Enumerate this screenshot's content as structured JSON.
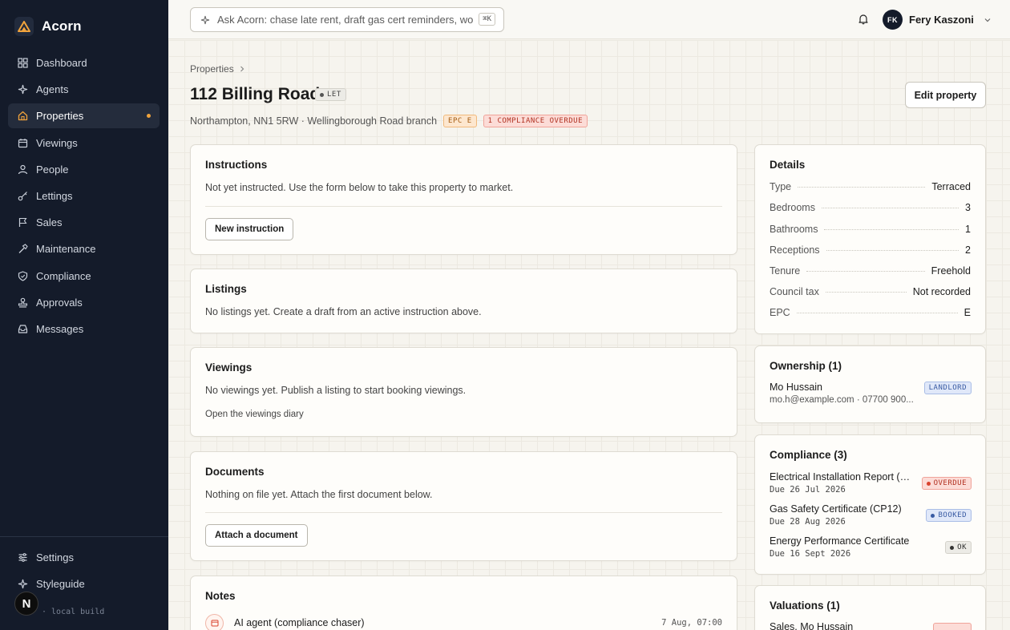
{
  "app": {
    "name": "Acorn",
    "build_label": "· local build"
  },
  "sidebar": {
    "items": [
      {
        "label": "Dashboard",
        "icon": "grid-icon"
      },
      {
        "label": "Agents",
        "icon": "sparkle-icon"
      },
      {
        "label": "Properties",
        "icon": "home-icon",
        "active": true
      },
      {
        "label": "Viewings",
        "icon": "calendar-icon"
      },
      {
        "label": "People",
        "icon": "person-icon"
      },
      {
        "label": "Lettings",
        "icon": "key-icon"
      },
      {
        "label": "Sales",
        "icon": "flag-icon"
      },
      {
        "label": "Maintenance",
        "icon": "hammer-icon"
      },
      {
        "label": "Compliance",
        "icon": "shield-icon"
      },
      {
        "label": "Approvals",
        "icon": "stamp-icon"
      },
      {
        "label": "Messages",
        "icon": "inbox-icon"
      }
    ],
    "bottom": [
      {
        "label": "Settings",
        "icon": "sliders-icon"
      },
      {
        "label": "Styleguide",
        "icon": "sparkle-icon"
      }
    ],
    "avatar_letter": "N",
    "active_dot_color": "#f0a33c"
  },
  "topbar": {
    "search_placeholder": "Ask Acorn: chase late rent, draft gas cert reminders, work th",
    "shortcut": "⌘K",
    "user_initials": "FK",
    "user_name": "Fery Kaszoni"
  },
  "page": {
    "breadcrumb": "Properties",
    "title": "112 Billing Road",
    "status_tag": "LET",
    "address": "Northampton, NN1 5RW · Wellingborough Road branch",
    "epc_tag": "EPC E",
    "overdue_tag": "1 COMPLIANCE OVERDUE",
    "edit_button": "Edit property"
  },
  "instructions": {
    "title": "Instructions",
    "text": "Not yet instructed. Use the form below to take this property to market.",
    "button": "New instruction"
  },
  "listings": {
    "title": "Listings",
    "text": "No listings yet. Create a draft from an active instruction above."
  },
  "viewings": {
    "title": "Viewings",
    "text": "No viewings yet. Publish a listing to start booking viewings.",
    "link": "Open the viewings diary"
  },
  "documents": {
    "title": "Documents",
    "text": "Nothing on file yet. Attach the first document below.",
    "button": "Attach a document"
  },
  "notes": {
    "title": "Notes",
    "items": [
      {
        "author": "AI agent (compliance chaser)",
        "time": "7 Aug, 07:00"
      }
    ]
  },
  "details": {
    "title": "Details",
    "rows": [
      {
        "label": "Type",
        "value": "Terraced"
      },
      {
        "label": "Bedrooms",
        "value": "3"
      },
      {
        "label": "Bathrooms",
        "value": "1"
      },
      {
        "label": "Receptions",
        "value": "2"
      },
      {
        "label": "Tenure",
        "value": "Freehold"
      },
      {
        "label": "Council tax",
        "value": "Not recorded"
      },
      {
        "label": "EPC",
        "value": "E"
      }
    ]
  },
  "ownership": {
    "title": "Ownership (1)",
    "name": "Mo Hussain",
    "contact": "mo.h@example.com · 07700 900...",
    "role_tag": "LANDLORD"
  },
  "compliance": {
    "title": "Compliance (3)",
    "items": [
      {
        "name": "Electrical Installation Report (E...",
        "due": "Due 26 Jul 2026",
        "status": "OVERDUE",
        "status_color": "#d9432e"
      },
      {
        "name": "Gas Safety Certificate (CP12)",
        "due": "Due 28 Aug 2026",
        "status": "BOOKED",
        "status_color": "#3a5ca3"
      },
      {
        "name": "Energy Performance Certificate",
        "due": "Due 16 Sept 2026",
        "status": "OK",
        "status_color": "#333333"
      }
    ]
  },
  "valuations": {
    "title": "Valuations (1)",
    "item": "Sales, Mo Hussain"
  }
}
